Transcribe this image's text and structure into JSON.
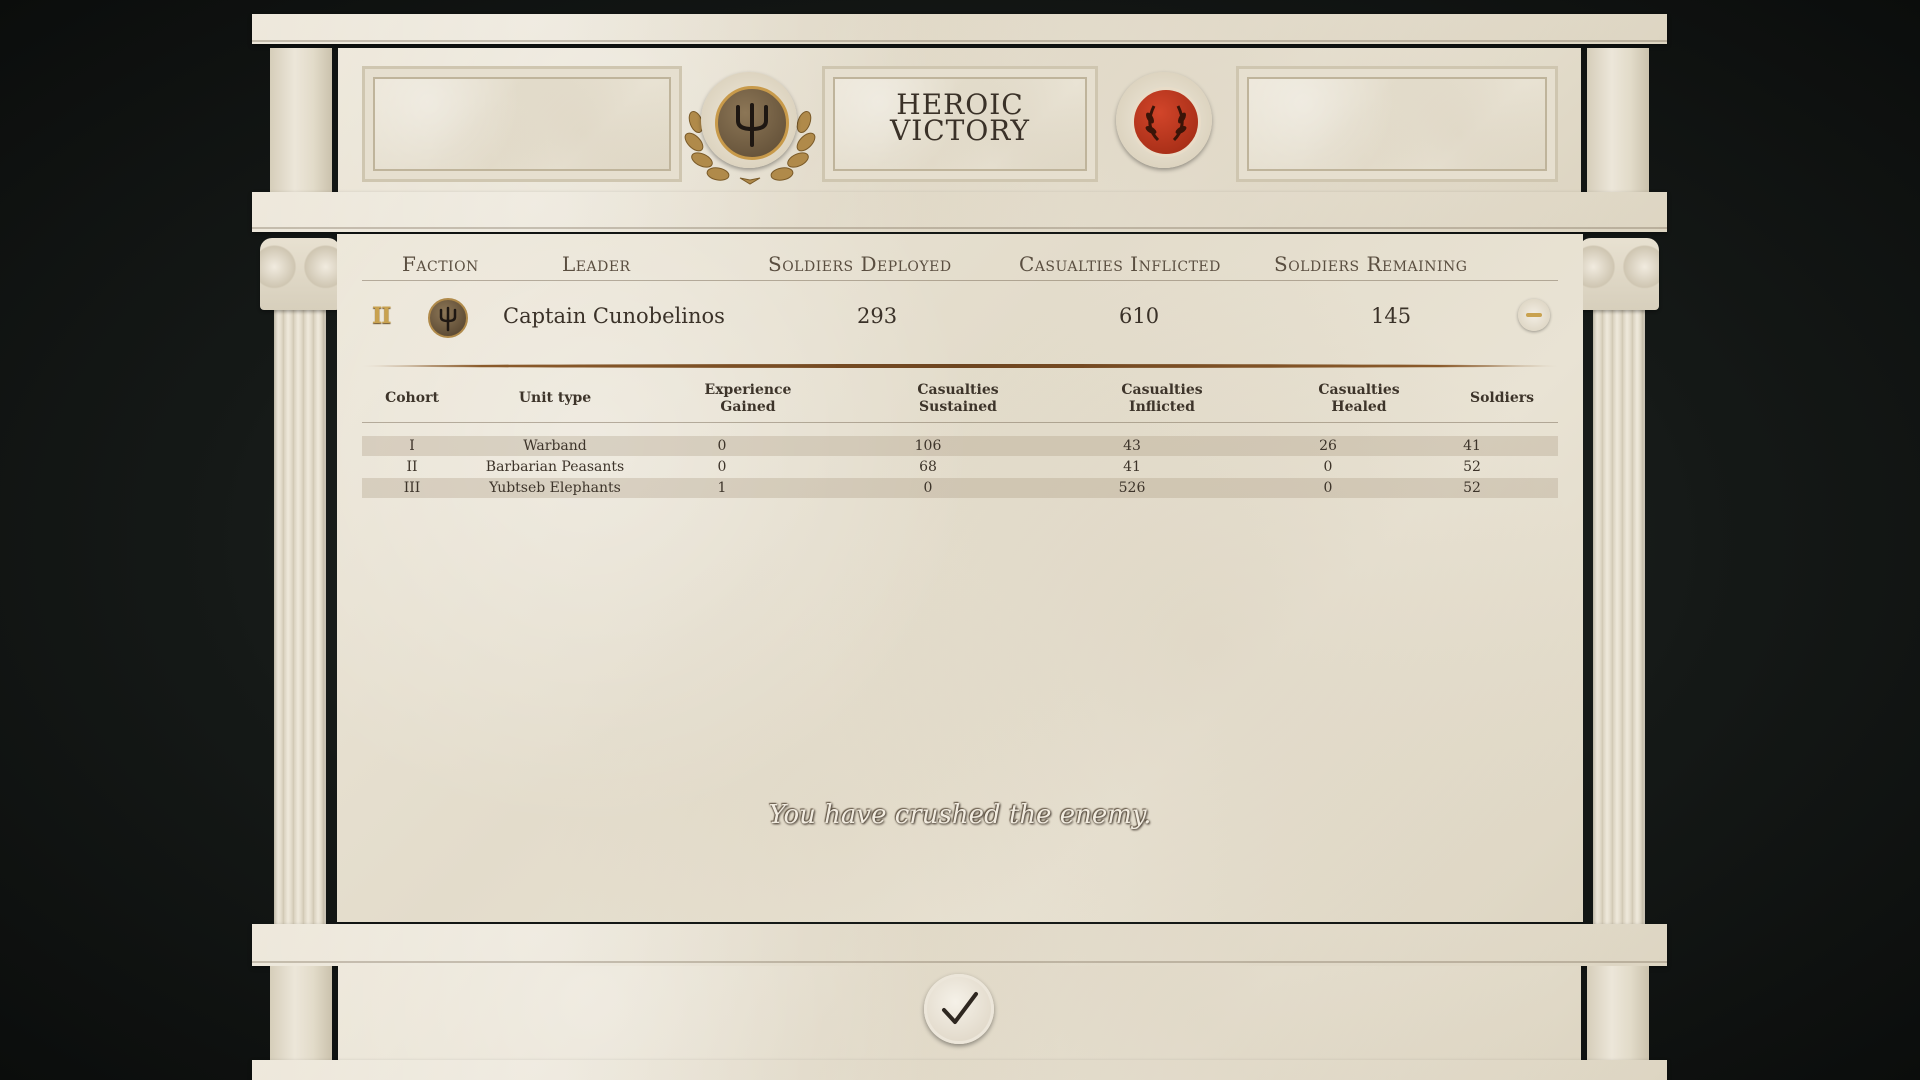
{
  "header": {
    "result_line1": "HEROIC",
    "result_line2": "VICTORY",
    "player_emblem": "trident-icon",
    "enemy_emblem": "laurel-wreath-icon"
  },
  "summary": {
    "columns": [
      "Faction",
      "Leader",
      "Soldiers Deployed",
      "Casualties Inflicted",
      "Soldiers Remaining"
    ],
    "row": {
      "rank": "II",
      "faction_icon": "trident-icon",
      "leader": "Captain Cunobelinos",
      "deployed": "293",
      "inflicted": "610",
      "remaining": "145"
    }
  },
  "cohorts": {
    "headers": {
      "cohort": "Cohort",
      "unit_type": "Unit type",
      "exp1": "Experience",
      "exp2": "Gained",
      "sus1": "Casualties",
      "sus2": "Sustained",
      "inf1": "Casualties",
      "inf2": "Inflicted",
      "heal1": "Casualties",
      "heal2": "Healed",
      "soldiers": "Soldiers"
    },
    "rows": [
      {
        "cohort": "I",
        "unit": "Warband",
        "exp": "0",
        "sustained": "106",
        "inflicted": "43",
        "healed": "26",
        "soldiers": "41"
      },
      {
        "cohort": "II",
        "unit": "Barbarian Peasants",
        "exp": "0",
        "sustained": "68",
        "inflicted": "41",
        "healed": "0",
        "soldiers": "52"
      },
      {
        "cohort": "III",
        "unit": "Yubtseb Elephants",
        "exp": "1",
        "sustained": "0",
        "inflicted": "526",
        "healed": "0",
        "soldiers": "52"
      }
    ]
  },
  "message": "You have crushed the enemy.",
  "confirm_icon": "checkmark-icon",
  "colors": {
    "marble": "#e6dfcf",
    "text_dark": "#3a3128",
    "divider": "#8a5a2a",
    "enemy_red": "#b5321d",
    "bronze": "#b08a4a"
  }
}
